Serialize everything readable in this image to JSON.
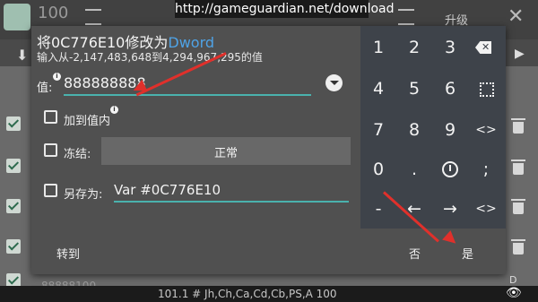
{
  "watermark": {
    "url": "http://gameguardian.net/download"
  },
  "background": {
    "top_number": "100",
    "top_right_label": "升级",
    "rows": [
      {
        "partial_value": "88888100",
        "partial_type": "D"
      }
    ],
    "status_line": "101.1 # Jh,Ch,Ca,Cd,Cb,PS,A 100"
  },
  "dialog": {
    "title_prefix": "将0C776E10修改为",
    "title_type": "Dword",
    "range_hint": "输入从-2,147,483,648到4,294,967,295的值",
    "value_label": "值:",
    "value": "888888888",
    "add_to_value_label": "加到值内",
    "freeze_label": "冻结:",
    "freeze_mode": "正常",
    "save_as_label": "另存为:",
    "save_as_value": "Var #0C776E10",
    "goto_button": "转到",
    "no_button": "否",
    "yes_button": "是"
  },
  "keypad": {
    "keys": [
      "1",
      "2",
      "3",
      "4",
      "5",
      "6",
      "7",
      "8",
      "9",
      "0",
      ".",
      "-",
      "←",
      "→",
      "<>"
    ],
    "icons": [
      "backspace-icon",
      "select-all-icon",
      "history-icon"
    ],
    "semicolon": ";"
  },
  "colors": {
    "accent": "#4ab2ad",
    "title_type": "#4fa3e6",
    "annotation": "#e0302b"
  }
}
